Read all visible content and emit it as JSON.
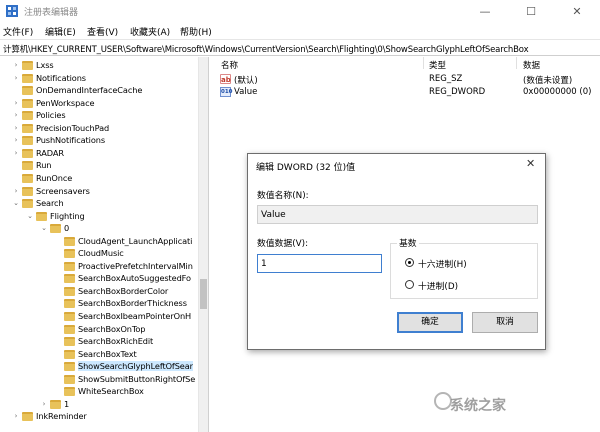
{
  "window": {
    "title": "注册表编辑器",
    "min_glyph": "—",
    "max_glyph": "☐",
    "close_glyph": "✕"
  },
  "menu": [
    "文件(F)",
    "编辑(E)",
    "查看(V)",
    "收藏夹(A)",
    "帮助(H)"
  ],
  "address": "计算机\\HKEY_CURRENT_USER\\Software\\Microsoft\\Windows\\CurrentVersion\\Search\\Flighting\\0\\ShowSearchGlyphLeftOfSearchBox",
  "tree": {
    "items": [
      {
        "label": "Lxss",
        "level": 2,
        "expander": "›"
      },
      {
        "label": "Notifications",
        "level": 2,
        "expander": "›"
      },
      {
        "label": "OnDemandInterfaceCache",
        "level": 2,
        "expander": ""
      },
      {
        "label": "PenWorkspace",
        "level": 2,
        "expander": "›"
      },
      {
        "label": "Policies",
        "level": 2,
        "expander": "›"
      },
      {
        "label": "PrecisionTouchPad",
        "level": 2,
        "expander": "›"
      },
      {
        "label": "PushNotifications",
        "level": 2,
        "expander": "›"
      },
      {
        "label": "RADAR",
        "level": 2,
        "expander": "›"
      },
      {
        "label": "Run",
        "level": 2,
        "expander": ""
      },
      {
        "label": "RunOnce",
        "level": 2,
        "expander": ""
      },
      {
        "label": "Screensavers",
        "level": 2,
        "expander": "›"
      },
      {
        "label": "Search",
        "level": 2,
        "expander": "⌄"
      },
      {
        "label": "Flighting",
        "level": 3,
        "expander": "⌄"
      },
      {
        "label": "0",
        "level": 4,
        "expander": "⌄"
      },
      {
        "label": "CloudAgent_LaunchApplicati",
        "level": 5,
        "expander": ""
      },
      {
        "label": "CloudMusic",
        "level": 5,
        "expander": ""
      },
      {
        "label": "ProactivePrefetchIntervalMin",
        "level": 5,
        "expander": ""
      },
      {
        "label": "SearchBoxAutoSuggestedFo",
        "level": 5,
        "expander": ""
      },
      {
        "label": "SearchBoxBorderColor",
        "level": 5,
        "expander": ""
      },
      {
        "label": "SearchBoxBorderThickness",
        "level": 5,
        "expander": ""
      },
      {
        "label": "SearchBoxIbeamPointerOnH",
        "level": 5,
        "expander": ""
      },
      {
        "label": "SearchBoxOnTop",
        "level": 5,
        "expander": ""
      },
      {
        "label": "SearchBoxRichEdit",
        "level": 5,
        "expander": ""
      },
      {
        "label": "SearchBoxText",
        "level": 5,
        "expander": ""
      },
      {
        "label": "ShowSearchGlyphLeftOfSear",
        "level": 5,
        "expander": "",
        "selected": true
      },
      {
        "label": "ShowSubmitButtonRightOfSe",
        "level": 5,
        "expander": ""
      },
      {
        "label": "WhiteSearchBox",
        "level": 5,
        "expander": ""
      },
      {
        "label": "1",
        "level": 4,
        "expander": "›"
      },
      {
        "label": "InkReminder",
        "level": 2,
        "expander": "›"
      }
    ]
  },
  "values": {
    "headers": [
      "名称",
      "类型",
      "数据"
    ],
    "rows": [
      {
        "icon": "ab",
        "name": "(默认)",
        "type": "REG_SZ",
        "data": "(数值未设置)"
      },
      {
        "icon": "010",
        "name": "Value",
        "type": "REG_DWORD",
        "data": "0x00000000 (0)"
      }
    ]
  },
  "dialog": {
    "title": "编辑 DWORD (32 位)值",
    "close_glyph": "✕",
    "name_label": "数值名称(N):",
    "name_value": "Value",
    "data_label": "数值数据(V):",
    "data_value": "1",
    "base_label": "基数",
    "radio_hex": "十六进制(H)",
    "radio_dec": "十进制(D)",
    "selected_base": "hex",
    "ok_label": "确定",
    "cancel_label": "取消"
  },
  "watermark": "系统之家"
}
